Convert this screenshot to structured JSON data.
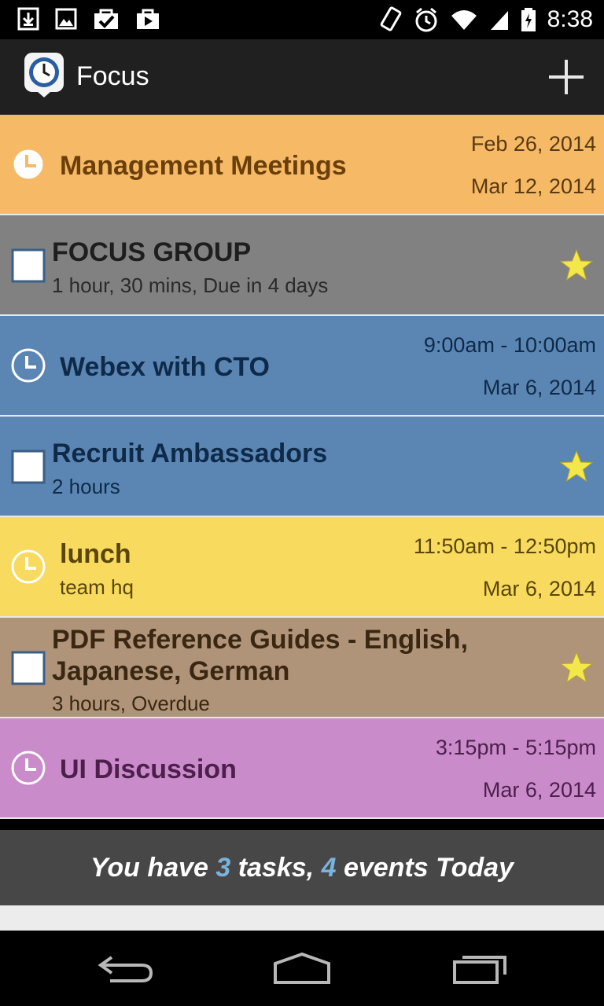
{
  "status_bar": {
    "time": "8:38",
    "left_icons": [
      "download-icon",
      "image-icon",
      "task-check-icon",
      "play-store-icon"
    ],
    "right_icons": [
      "vibrate-icon",
      "alarm-icon",
      "wifi-icon",
      "signal-icon",
      "battery-icon"
    ]
  },
  "app_bar": {
    "title": "Focus"
  },
  "items": [
    {
      "kind": "event",
      "title": "Management Meetings",
      "sub": "",
      "right_top": "Feb 26, 2014",
      "right_bottom": "Mar 12, 2014",
      "bg": "#f6b966",
      "fg": "#6b3f0a",
      "sub_fg": "#5a3a10",
      "icon_fill": "#ffffff",
      "icon_stroke": "#f6b966"
    },
    {
      "kind": "task",
      "title": "FOCUS GROUP",
      "sub": "1 hour, 30 mins, Due in 4 days",
      "starred": true,
      "bg": "#818181",
      "fg": "#1e1e1e",
      "sub_fg": "#2a2a2a"
    },
    {
      "kind": "event",
      "title": "Webex with CTO",
      "sub": "",
      "right_top": "9:00am - 10:00am",
      "right_bottom": "Mar 6, 2014",
      "bg": "#5b86b4",
      "fg": "#0e2a48",
      "sub_fg": "#0e2a48",
      "icon_fill": "none",
      "icon_stroke": "#ffffff"
    },
    {
      "kind": "task",
      "title": "Recruit Ambassadors",
      "sub": "2 hours",
      "starred": true,
      "bg": "#5b86b4",
      "fg": "#0e2a48",
      "sub_fg": "#0e2a48"
    },
    {
      "kind": "event",
      "title": "lunch",
      "sub": "team hq",
      "right_top": "11:50am - 12:50pm",
      "right_bottom": "Mar 6, 2014",
      "bg": "#f7da5e",
      "fg": "#5a4608",
      "sub_fg": "#5a4608",
      "icon_fill": "none",
      "icon_stroke": "#ffffff"
    },
    {
      "kind": "task",
      "title": "PDF Reference Guides - English, Japanese, German",
      "sub": "3 hours, Overdue",
      "starred": true,
      "bg": "#b09479",
      "fg": "#3a2712",
      "sub_fg": "#3a2712"
    },
    {
      "kind": "event",
      "title": "UI Discussion",
      "sub": "",
      "right_top": "3:15pm - 5:15pm",
      "right_bottom": "Mar 6, 2014",
      "bg": "#c98bc9",
      "fg": "#4d1f4d",
      "sub_fg": "#4d1f4d",
      "icon_fill": "none",
      "icon_stroke": "#ffffff"
    }
  ],
  "summary": {
    "prefix": "You have",
    "task_count": "3",
    "middle": "tasks,",
    "event_count": "4",
    "suffix": "events Today"
  },
  "colors": {
    "star": "#f3e84a",
    "checkbox_border": "#3b5f86",
    "summary_accent": "#7ab3dc"
  }
}
